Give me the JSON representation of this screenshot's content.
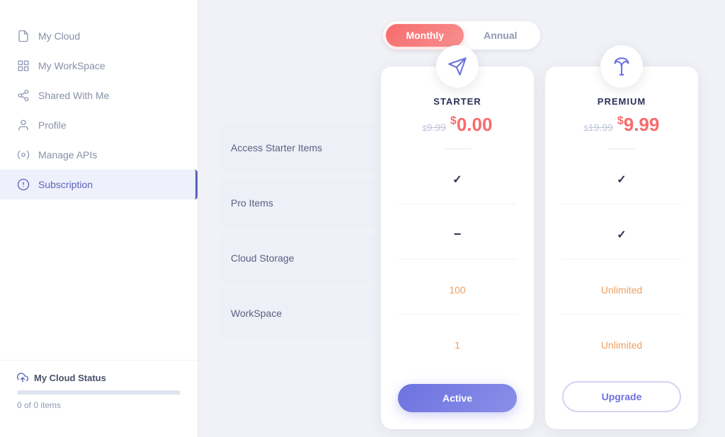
{
  "sidebar": {
    "items": [
      {
        "id": "my-cloud",
        "label": "My Cloud",
        "active": false
      },
      {
        "id": "my-workspace",
        "label": "My WorkSpace",
        "active": false
      },
      {
        "id": "shared-with-me",
        "label": "Shared With Me",
        "active": false
      },
      {
        "id": "profile",
        "label": "Profile",
        "active": false
      },
      {
        "id": "manage-apis",
        "label": "Manage APIs",
        "active": false
      },
      {
        "id": "subscription",
        "label": "Subscription",
        "active": true
      }
    ],
    "footer": {
      "title": "My Cloud Status",
      "count": "0 of 0 items",
      "progress": 0
    }
  },
  "toggle": {
    "monthly_label": "Monthly",
    "annual_label": "Annual",
    "active": "monthly"
  },
  "features": [
    {
      "label": "Access Starter Items"
    },
    {
      "label": "Pro Items"
    },
    {
      "label": "Cloud Storage"
    },
    {
      "label": "WorkSpace"
    }
  ],
  "plans": [
    {
      "id": "starter",
      "name": "STARTER",
      "old_price": "9.99",
      "new_price": "0.00",
      "icon": "paper-plane",
      "values": [
        {
          "type": "check"
        },
        {
          "type": "dash"
        },
        {
          "type": "number",
          "value": "100"
        },
        {
          "type": "number",
          "value": "1"
        }
      ],
      "button_label": "Active",
      "button_type": "active"
    },
    {
      "id": "premium",
      "name": "PREMIUM",
      "old_price": "19.99",
      "new_price": "9.99",
      "icon": "parachute",
      "values": [
        {
          "type": "check"
        },
        {
          "type": "check"
        },
        {
          "type": "unlimited",
          "value": "Unlimited"
        },
        {
          "type": "unlimited",
          "value": "Unlimited"
        }
      ],
      "button_label": "Upgrade",
      "button_type": "upgrade"
    }
  ]
}
